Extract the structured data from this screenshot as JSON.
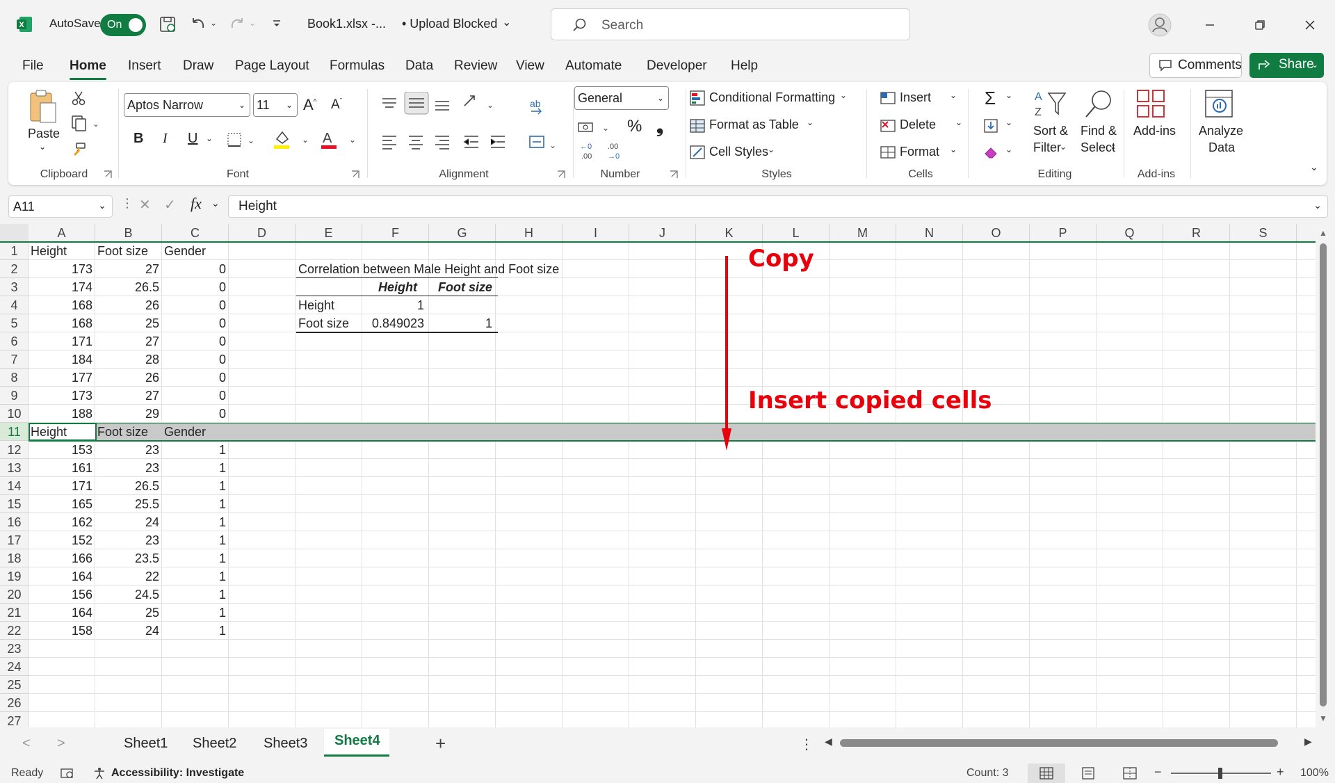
{
  "titlebar": {
    "autosave_label": "AutoSave",
    "autosave_state": "On",
    "filename": "Book1.xlsx  -...",
    "upload_status": "• Upload Blocked",
    "search_placeholder": "Search"
  },
  "menu": {
    "tabs": [
      "File",
      "Home",
      "Insert",
      "Draw",
      "Page Layout",
      "Formulas",
      "Data",
      "Review",
      "View",
      "Automate",
      "Developer",
      "Help"
    ],
    "active": "Home",
    "comments_label": "Comments",
    "share_label": "Share"
  },
  "ribbon": {
    "clipboard": {
      "paste": "Paste",
      "label": "Clipboard"
    },
    "font": {
      "family": "Aptos Narrow",
      "size": "11",
      "bold": "B",
      "italic": "I",
      "underline": "U",
      "label": "Font"
    },
    "alignment": {
      "label": "Alignment"
    },
    "number": {
      "format": "General",
      "percent": "%",
      "comma": "❟",
      "label": "Number"
    },
    "styles": {
      "conditional": "Conditional Formatting",
      "format_table": "Format as Table",
      "cell_styles": "Cell Styles",
      "label": "Styles"
    },
    "cells": {
      "insert": "Insert",
      "delete": "Delete",
      "format": "Format",
      "label": "Cells"
    },
    "editing": {
      "sort_filter_1": "Sort &",
      "sort_filter_2": "Filter",
      "find_select_1": "Find &",
      "find_select_2": "Select",
      "label": "Editing"
    },
    "addins": {
      "addins": "Add-ins",
      "label": "Add-ins"
    },
    "analyze": {
      "line1": "Analyze",
      "line2": "Data"
    }
  },
  "formula_bar": {
    "name_box": "A11",
    "fx": "fx",
    "content": "Height"
  },
  "grid": {
    "columns": [
      "A",
      "B",
      "C",
      "D",
      "E",
      "F",
      "G",
      "H",
      "I",
      "J",
      "K",
      "L",
      "M",
      "N",
      "O",
      "P",
      "Q",
      "R",
      "S"
    ],
    "selected_row": 11,
    "rows": [
      {
        "r": 1,
        "a": "Height",
        "b": "Foot size",
        "c": "Gender"
      },
      {
        "r": 2,
        "a": "173",
        "b": "27",
        "c": "0"
      },
      {
        "r": 3,
        "a": "174",
        "b": "26.5",
        "c": "0"
      },
      {
        "r": 4,
        "a": "168",
        "b": "26",
        "c": "0"
      },
      {
        "r": 5,
        "a": "168",
        "b": "25",
        "c": "0"
      },
      {
        "r": 6,
        "a": "171",
        "b": "27",
        "c": "0"
      },
      {
        "r": 7,
        "a": "184",
        "b": "28",
        "c": "0"
      },
      {
        "r": 8,
        "a": "177",
        "b": "26",
        "c": "0"
      },
      {
        "r": 9,
        "a": "173",
        "b": "27",
        "c": "0"
      },
      {
        "r": 10,
        "a": "188",
        "b": "29",
        "c": "0"
      },
      {
        "r": 11,
        "a": "Height",
        "b": "Foot size",
        "c": "Gender"
      },
      {
        "r": 12,
        "a": "153",
        "b": "23",
        "c": "1"
      },
      {
        "r": 13,
        "a": "161",
        "b": "23",
        "c": "1"
      },
      {
        "r": 14,
        "a": "171",
        "b": "26.5",
        "c": "1"
      },
      {
        "r": 15,
        "a": "165",
        "b": "25.5",
        "c": "1"
      },
      {
        "r": 16,
        "a": "162",
        "b": "24",
        "c": "1"
      },
      {
        "r": 17,
        "a": "152",
        "b": "23",
        "c": "1"
      },
      {
        "r": 18,
        "a": "166",
        "b": "23.5",
        "c": "1"
      },
      {
        "r": 19,
        "a": "164",
        "b": "22",
        "c": "1"
      },
      {
        "r": 20,
        "a": "156",
        "b": "24.5",
        "c": "1"
      },
      {
        "r": 21,
        "a": "164",
        "b": "25",
        "c": "1"
      },
      {
        "r": 22,
        "a": "158",
        "b": "24",
        "c": "1"
      },
      {
        "r": 23
      },
      {
        "r": 24
      },
      {
        "r": 25
      },
      {
        "r": 26
      },
      {
        "r": 27
      }
    ],
    "correlation": {
      "title": "Correlation between Male Height and Foot size",
      "header_1": "Height",
      "header_2": "Foot size",
      "row1_label": "Height",
      "row1_val": "1",
      "row2_label": "Foot size",
      "row2_val1": "0.849023",
      "row2_val2": "1"
    }
  },
  "annotations": {
    "copy_label": "Copy",
    "insert_label": "Insert copied cells",
    "color": "#e8000b"
  },
  "sheets": {
    "tabs": [
      "Sheet1",
      "Sheet2",
      "Sheet3",
      "Sheet4"
    ],
    "active": "Sheet4",
    "add_label": "+"
  },
  "status": {
    "ready": "Ready",
    "accessibility": "Accessibility: Investigate",
    "count": "Count: 3",
    "zoom": "100%"
  },
  "colors": {
    "accent": "#107c41",
    "selection_band": "#c9c9c9"
  }
}
